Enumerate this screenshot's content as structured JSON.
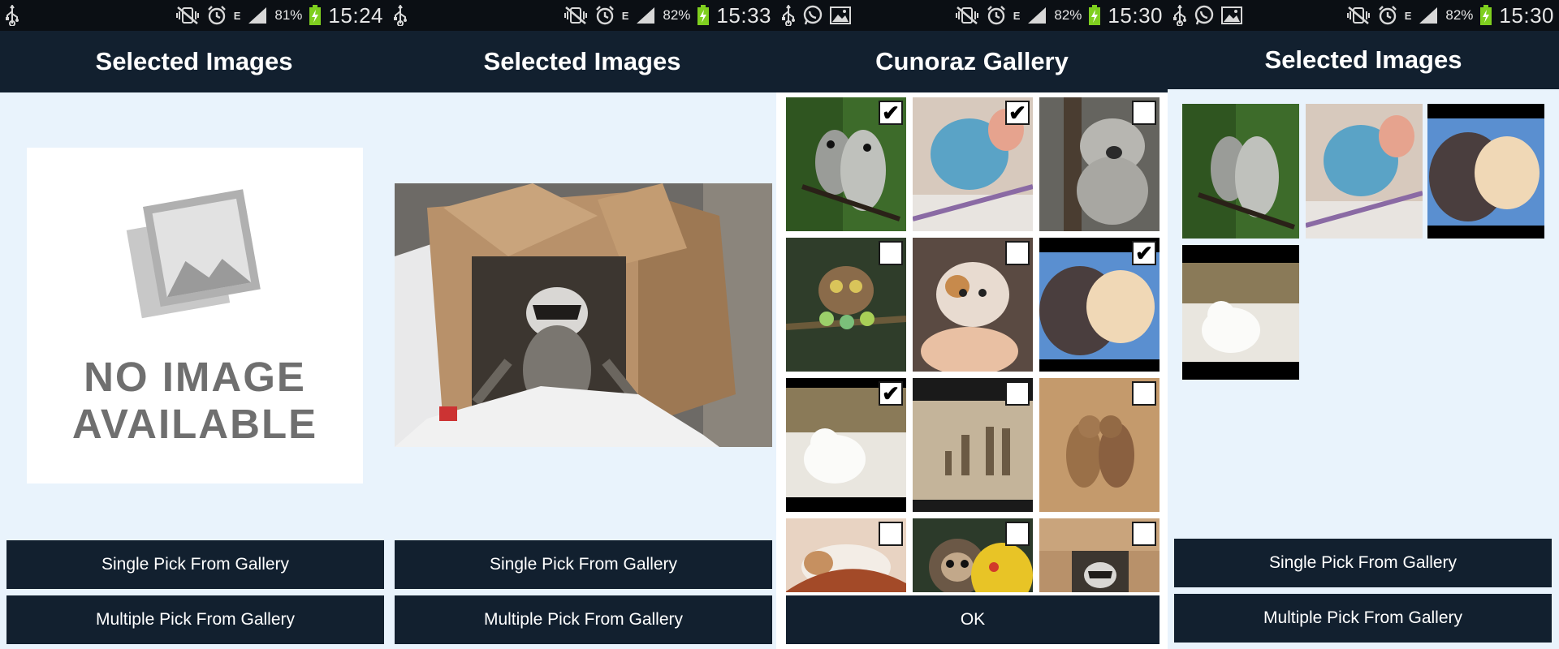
{
  "panels": [
    {
      "status": {
        "battery_pct": "81%",
        "time": "15:24",
        "network": "E"
      },
      "title": "Selected Images",
      "placeholder": {
        "line1": "NO IMAGE",
        "line2": "AVAILABLE"
      },
      "buttons": {
        "single": "Single Pick From Gallery",
        "multiple": "Multiple Pick From Gallery"
      }
    },
    {
      "status": {
        "battery_pct": "82%",
        "time": "15:33",
        "network": "E"
      },
      "title": "Selected Images",
      "buttons": {
        "single": "Single Pick From Gallery",
        "multiple": "Multiple Pick From Gallery"
      }
    },
    {
      "status": {
        "battery_pct": "82%",
        "time": "15:30",
        "network": "E"
      },
      "title": "Cunoraz Gallery",
      "grid": [
        {
          "subject": "owls",
          "checked": true
        },
        {
          "subject": "blue bird",
          "checked": true
        },
        {
          "subject": "koala",
          "checked": false
        },
        {
          "subject": "owl chick with birds",
          "checked": false
        },
        {
          "subject": "kitten in hand",
          "checked": false
        },
        {
          "subject": "hedgehog and hamster",
          "checked": true
        },
        {
          "subject": "polar bear cub",
          "checked": true
        },
        {
          "subject": "meerkats",
          "checked": false
        },
        {
          "subject": "ground squirrels",
          "checked": false
        },
        {
          "subject": "kitten sleeping",
          "checked": false
        },
        {
          "subject": "sloth with toy",
          "checked": false
        },
        {
          "subject": "raccoon in box",
          "checked": false
        }
      ],
      "ok_label": "OK"
    },
    {
      "status": {
        "battery_pct": "82%",
        "time": "15:30",
        "network": "E"
      },
      "title": "Selected Images",
      "buttons": {
        "single": "Single Pick From Gallery",
        "multiple": "Multiple Pick From Gallery"
      }
    }
  ],
  "icons": {
    "status_left": [
      "usb-icon",
      "whatsapp-icon",
      "gallery-icon"
    ],
    "status_right": [
      "mute-vibrate-icon",
      "alarm-icon",
      "signal-icon",
      "battery-charging-icon"
    ],
    "checkbox_mark": "✔"
  },
  "colors": {
    "bar": "#12202f",
    "status": "#0b0f14",
    "background": "#e9f3fc",
    "battery": "#7fcf1f"
  }
}
